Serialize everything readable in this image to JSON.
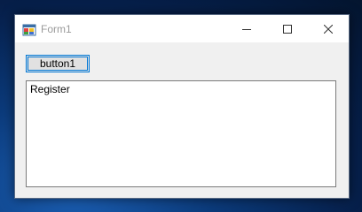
{
  "window": {
    "title": "Form1",
    "icon": "form-app-icon",
    "controls": [
      "minimize-icon",
      "maximize-icon",
      "close-icon"
    ]
  },
  "form": {
    "button1_label": "button1",
    "textbox_text": "Register"
  },
  "colors": {
    "focus_border": "#0078d7",
    "titlebar_bg": "#ffffff",
    "form_bg": "#f0f0f0",
    "title_text": "#9a9a9a"
  }
}
